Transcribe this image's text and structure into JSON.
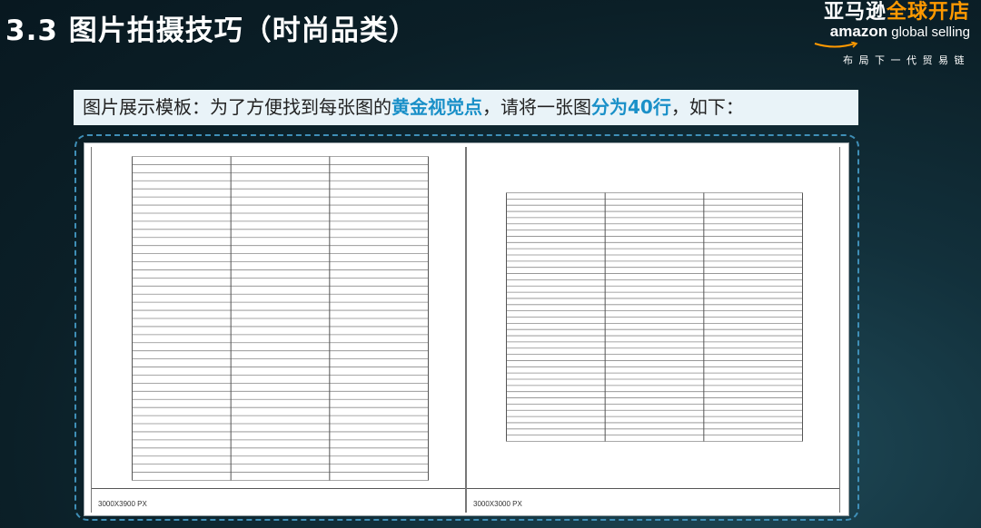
{
  "slide": {
    "title": "3.3 图片拍摄技巧（时尚品类）"
  },
  "brand": {
    "cn_part1": "亚马逊",
    "cn_part2": "全球开店",
    "en_part1": "amazon",
    "en_part2": " global selling",
    "tagline": "布局下一代贸易链",
    "colors": {
      "orange": "#ff9900",
      "white": "#ffffff"
    }
  },
  "instruction": {
    "part1": "图片展示模板：为了方便找到每张图的",
    "highlight1": "黄金视觉点",
    "part2": "，请将一张图",
    "highlight2": "分为40行",
    "part3": "，如下：",
    "highlight_color": "#1a90c8"
  },
  "templates": [
    {
      "caption": "3000X3900 PX",
      "rows": 40,
      "columns": 3
    },
    {
      "caption": "3000X3000 PX",
      "rows": 40,
      "columns": 3
    }
  ]
}
